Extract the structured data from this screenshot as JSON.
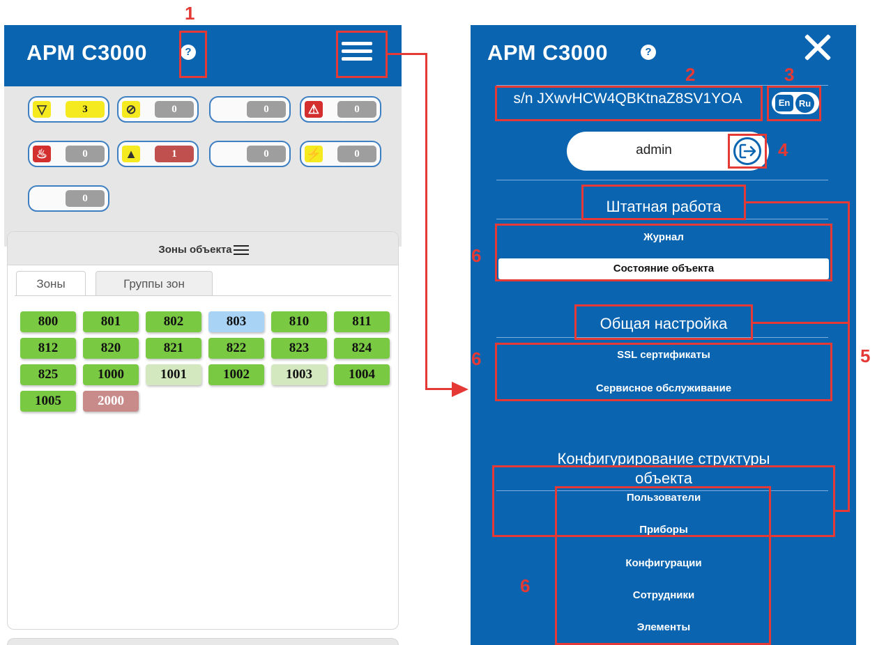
{
  "app": {
    "title": "АРМ С3000",
    "help_icon": "?"
  },
  "status_counters": [
    {
      "icon": "▽",
      "icon_name": "fault-triangle-icon",
      "icon_bg": "#f5ea1f",
      "value": "3",
      "value_bg": "#f5ea1f",
      "value_color": "#111111"
    },
    {
      "icon": "⊘",
      "icon_name": "blocked-icon",
      "icon_bg": "#f5ea1f",
      "value": "0",
      "value_bg": "#9e9e9e",
      "value_color": "#ffffff"
    },
    {
      "icon": "",
      "icon_name": "blank-icon",
      "icon_bg": "transparent",
      "value": "0",
      "value_bg": "#9e9e9e",
      "value_color": "#ffffff"
    },
    {
      "icon": "⚠",
      "icon_name": "siren-icon",
      "icon_bg": "#d32f2f",
      "value": "0",
      "value_bg": "#9e9e9e",
      "value_color": "#ffffff"
    },
    {
      "icon": "♨",
      "icon_name": "fire-icon",
      "icon_bg": "#d32f2f",
      "value": "0",
      "value_bg": "#9e9e9e",
      "value_color": "#ffffff"
    },
    {
      "icon": "▲",
      "icon_name": "warning-icon",
      "icon_bg": "#f5ea1f",
      "value": "1",
      "value_bg": "#c0504d",
      "value_color": "#ffffff"
    },
    {
      "icon": "",
      "icon_name": "blank-icon",
      "icon_bg": "transparent",
      "value": "0",
      "value_bg": "#9e9e9e",
      "value_color": "#ffffff"
    },
    {
      "icon": "⚡",
      "icon_name": "power-icon",
      "icon_bg": "#f5ea1f",
      "value": "0",
      "value_bg": "#9e9e9e",
      "value_color": "#ffffff"
    },
    {
      "icon": "",
      "icon_name": "blank-icon",
      "icon_bg": "transparent",
      "value": "0",
      "value_bg": "#9e9e9e",
      "value_color": "#ffffff"
    }
  ],
  "zones_panel": {
    "title": "Зоны объекта",
    "tabs": [
      "Зоны",
      "Группы зон"
    ],
    "zones": [
      {
        "label": "800",
        "color": "#7ac943"
      },
      {
        "label": "801",
        "color": "#7ac943"
      },
      {
        "label": "802",
        "color": "#7ac943"
      },
      {
        "label": "803",
        "color": "#a9d3f5"
      },
      {
        "label": "810",
        "color": "#7ac943"
      },
      {
        "label": "811",
        "color": "#7ac943"
      },
      {
        "label": "812",
        "color": "#7ac943"
      },
      {
        "label": "820",
        "color": "#7ac943"
      },
      {
        "label": "821",
        "color": "#7ac943"
      },
      {
        "label": "822",
        "color": "#7ac943"
      },
      {
        "label": "823",
        "color": "#7ac943"
      },
      {
        "label": "824",
        "color": "#7ac943"
      },
      {
        "label": "825",
        "color": "#7ac943"
      },
      {
        "label": "1000",
        "color": "#7ac943"
      },
      {
        "label": "1001",
        "color": "#d4e8c0"
      },
      {
        "label": "1002",
        "color": "#7ac943"
      },
      {
        "label": "1003",
        "color": "#d4e8c0"
      },
      {
        "label": "1004",
        "color": "#7ac943"
      },
      {
        "label": "1005",
        "color": "#7ac943"
      },
      {
        "label": "2000",
        "color": "#c98a8a"
      }
    ]
  },
  "side_menu": {
    "title": "АРМ С3000",
    "serial": "s/n JXwvHCW4QBKtnaZ8SV1YOA",
    "lang_en": "En",
    "lang_ru": "Ru",
    "user": "admin",
    "sections": [
      {
        "title": "Штатная работа",
        "items": [
          "Журнал",
          "Состояние объекта"
        ],
        "active": "Состояние объекта"
      },
      {
        "title": "Общая настройка",
        "items": [
          "SSL сертификаты",
          "Сервисное обслуживание"
        ]
      },
      {
        "title_line1": "Конфигурирование структуры",
        "title_line2": "объекта",
        "items": [
          "Пользователи",
          "Приборы",
          "Конфигурации",
          "Сотрудники",
          "Элементы"
        ]
      }
    ]
  },
  "annotations": [
    "1",
    "2",
    "3",
    "4",
    "5",
    "6",
    "6",
    "6"
  ],
  "colors": {
    "header_blue": "#0a64b0",
    "annotation_red": "#e53935"
  }
}
